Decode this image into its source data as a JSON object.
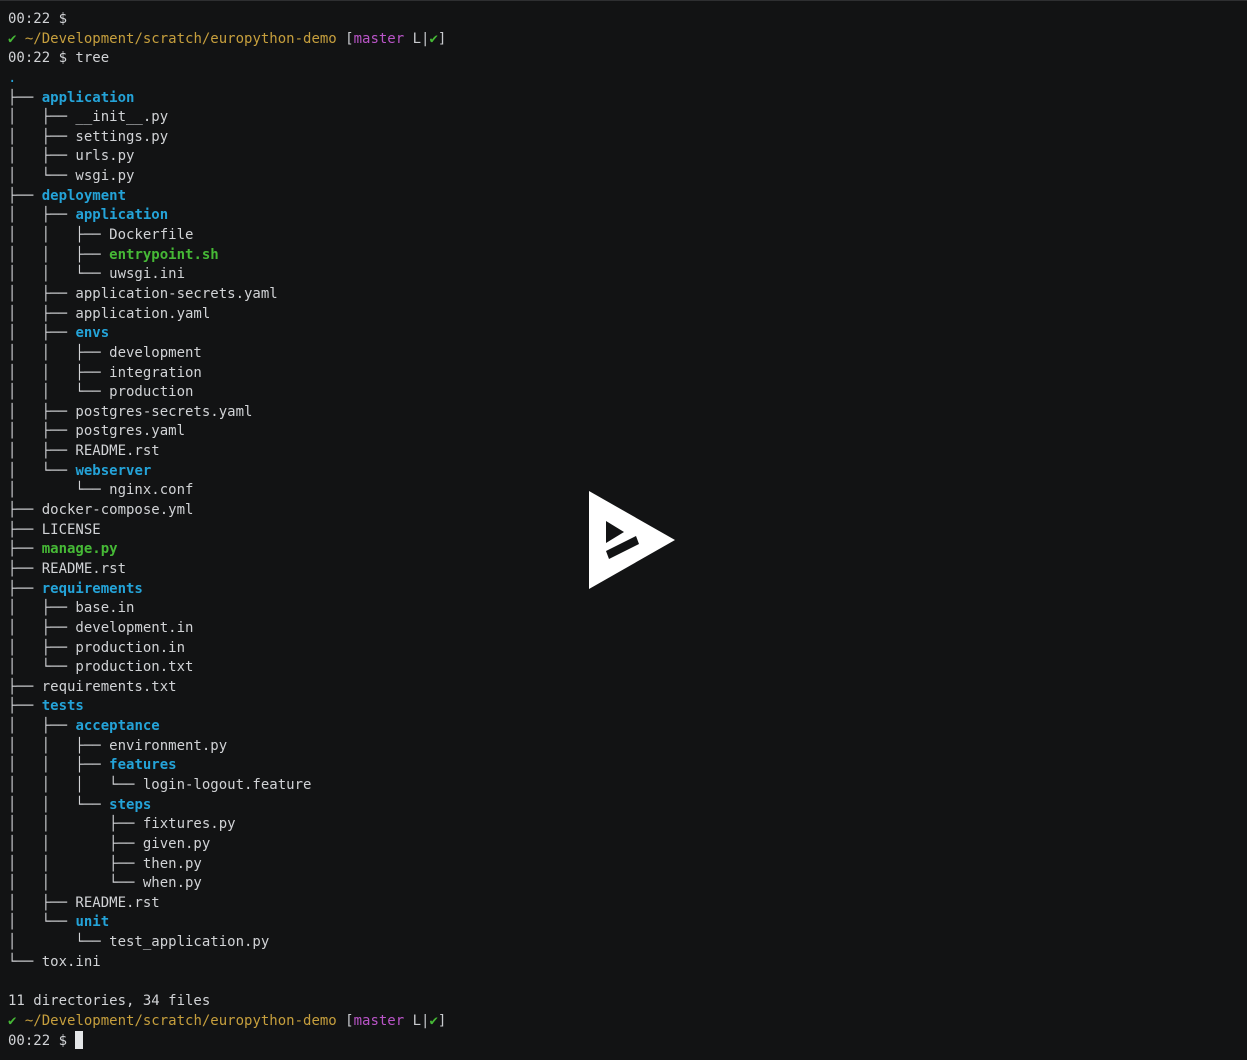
{
  "colors": {
    "background": "#121314",
    "text": "#d1d3d6",
    "directory": "#24a3d8",
    "executable": "#46b936",
    "path": "#c69f3d",
    "branch": "#b954c7",
    "cursor": "#e4e6e8",
    "overlay_icon": "#ffffff"
  },
  "overlay": {
    "icon": "asciinema-play-icon"
  },
  "terminal": {
    "lines": [
      [
        {
          "t": "00:22 $ ",
          "s": "normal"
        }
      ],
      [
        {
          "t": "✔",
          "s": "check"
        },
        {
          "t": " ~/Development/scratch/europython-demo",
          "s": "path"
        },
        {
          "t": " [",
          "s": "muted"
        },
        {
          "t": "master",
          "s": "branch"
        },
        {
          "t": " L|",
          "s": "muted"
        },
        {
          "t": "✔",
          "s": "check"
        },
        {
          "t": "]",
          "s": "muted"
        }
      ],
      [
        {
          "t": "00:22 $ tree",
          "s": "normal"
        }
      ],
      [
        {
          "t": ".",
          "s": "dot"
        }
      ],
      [
        {
          "t": "├── ",
          "s": "normal"
        },
        {
          "t": "application",
          "s": "dir"
        }
      ],
      [
        {
          "t": "│   ├── __init__.py",
          "s": "normal"
        }
      ],
      [
        {
          "t": "│   ├── settings.py",
          "s": "normal"
        }
      ],
      [
        {
          "t": "│   ├── urls.py",
          "s": "normal"
        }
      ],
      [
        {
          "t": "│   └── wsgi.py",
          "s": "normal"
        }
      ],
      [
        {
          "t": "├── ",
          "s": "normal"
        },
        {
          "t": "deployment",
          "s": "dir"
        }
      ],
      [
        {
          "t": "│   ├── ",
          "s": "normal"
        },
        {
          "t": "application",
          "s": "dir"
        }
      ],
      [
        {
          "t": "│   │   ├── Dockerfile",
          "s": "normal"
        }
      ],
      [
        {
          "t": "│   │   ├── ",
          "s": "normal"
        },
        {
          "t": "entrypoint.sh",
          "s": "exec"
        }
      ],
      [
        {
          "t": "│   │   └── uwsgi.ini",
          "s": "normal"
        }
      ],
      [
        {
          "t": "│   ├── application-secrets.yaml",
          "s": "normal"
        }
      ],
      [
        {
          "t": "│   ├── application.yaml",
          "s": "normal"
        }
      ],
      [
        {
          "t": "│   ├── ",
          "s": "normal"
        },
        {
          "t": "envs",
          "s": "dir"
        }
      ],
      [
        {
          "t": "│   │   ├── development",
          "s": "normal"
        }
      ],
      [
        {
          "t": "│   │   ├── integration",
          "s": "normal"
        }
      ],
      [
        {
          "t": "│   │   └── production",
          "s": "normal"
        }
      ],
      [
        {
          "t": "│   ├── postgres-secrets.yaml",
          "s": "normal"
        }
      ],
      [
        {
          "t": "│   ├── postgres.yaml",
          "s": "normal"
        }
      ],
      [
        {
          "t": "│   ├── README.rst",
          "s": "normal"
        }
      ],
      [
        {
          "t": "│   └── ",
          "s": "normal"
        },
        {
          "t": "webserver",
          "s": "dir"
        }
      ],
      [
        {
          "t": "│       └── nginx.conf",
          "s": "normal"
        }
      ],
      [
        {
          "t": "├── docker-compose.yml",
          "s": "normal"
        }
      ],
      [
        {
          "t": "├── LICENSE",
          "s": "normal"
        }
      ],
      [
        {
          "t": "├── ",
          "s": "normal"
        },
        {
          "t": "manage.py",
          "s": "exec"
        }
      ],
      [
        {
          "t": "├── README.rst",
          "s": "normal"
        }
      ],
      [
        {
          "t": "├── ",
          "s": "normal"
        },
        {
          "t": "requirements",
          "s": "dir"
        }
      ],
      [
        {
          "t": "│   ├── base.in",
          "s": "normal"
        }
      ],
      [
        {
          "t": "│   ├── development.in",
          "s": "normal"
        }
      ],
      [
        {
          "t": "│   ├── production.in",
          "s": "normal"
        }
      ],
      [
        {
          "t": "│   └── production.txt",
          "s": "normal"
        }
      ],
      [
        {
          "t": "├── requirements.txt",
          "s": "normal"
        }
      ],
      [
        {
          "t": "├── ",
          "s": "normal"
        },
        {
          "t": "tests",
          "s": "dir"
        }
      ],
      [
        {
          "t": "│   ├── ",
          "s": "normal"
        },
        {
          "t": "acceptance",
          "s": "dir"
        }
      ],
      [
        {
          "t": "│   │   ├── environment.py",
          "s": "normal"
        }
      ],
      [
        {
          "t": "│   │   ├── ",
          "s": "normal"
        },
        {
          "t": "features",
          "s": "dir"
        }
      ],
      [
        {
          "t": "│   │   │   └── login-logout.feature",
          "s": "normal"
        }
      ],
      [
        {
          "t": "│   │   └── ",
          "s": "normal"
        },
        {
          "t": "steps",
          "s": "dir"
        }
      ],
      [
        {
          "t": "│   │       ├── fixtures.py",
          "s": "normal"
        }
      ],
      [
        {
          "t": "│   │       ├── given.py",
          "s": "normal"
        }
      ],
      [
        {
          "t": "│   │       ├── then.py",
          "s": "normal"
        }
      ],
      [
        {
          "t": "│   │       └── when.py",
          "s": "normal"
        }
      ],
      [
        {
          "t": "│   ├── README.rst",
          "s": "normal"
        }
      ],
      [
        {
          "t": "│   └── ",
          "s": "normal"
        },
        {
          "t": "unit",
          "s": "dir"
        }
      ],
      [
        {
          "t": "│       └── test_application.py",
          "s": "normal"
        }
      ],
      [
        {
          "t": "└── tox.ini",
          "s": "normal"
        }
      ],
      [
        {
          "t": "",
          "s": "normal"
        }
      ],
      [
        {
          "t": "11 directories, 34 files",
          "s": "normal"
        }
      ],
      [
        {
          "t": "✔",
          "s": "check"
        },
        {
          "t": " ~/Development/scratch/europython-demo",
          "s": "path"
        },
        {
          "t": " [",
          "s": "muted"
        },
        {
          "t": "master",
          "s": "branch"
        },
        {
          "t": " L|",
          "s": "muted"
        },
        {
          "t": "✔",
          "s": "check"
        },
        {
          "t": "]",
          "s": "muted"
        }
      ],
      [
        {
          "t": "00:22 $ ",
          "s": "normal"
        },
        {
          "t": "",
          "s": "cursor"
        }
      ]
    ]
  }
}
